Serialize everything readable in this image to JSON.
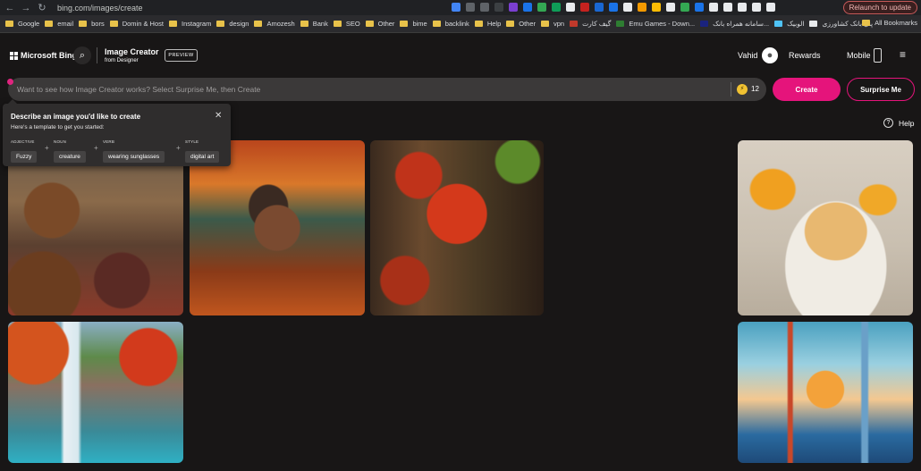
{
  "browser": {
    "url": "bing.com/images/create",
    "relaunch_label": "Relaunch to update",
    "bookmarks": [
      "Google",
      "email",
      "bors",
      "Domin & Host",
      "Instagram",
      "design",
      "Amozesh",
      "Bank",
      "SEO",
      "Other",
      "bime",
      "backlink",
      "Help",
      "Other",
      "vpn",
      "گیف کارت",
      "Emu Games - Down...",
      "سامانه همراه بانک...",
      "الوبیک",
      "پنل بانک کشاورزی"
    ],
    "all_bookmarks_label": "All Bookmarks"
  },
  "header": {
    "brand": "Microsoft Bing",
    "title": "Image Creator",
    "subtitle": "from Designer",
    "preview_badge": "PREVIEW",
    "user_name": "Vahid",
    "rewards": "Rewards",
    "mobile": "Mobile"
  },
  "prompt": {
    "placeholder": "Want to see how Image Creator works? Select Surprise Me, then Create",
    "boost_count": "12",
    "create_label": "Create",
    "surprise_label": "Surprise Me"
  },
  "tooltip": {
    "title": "Describe an image you'd like to create",
    "subtitle": "Here's a template to get you started:",
    "chips": [
      {
        "label": "ADJECTIVE",
        "value": "Fuzzy"
      },
      {
        "label": "NOUN",
        "value": "creature"
      },
      {
        "label": "VERB",
        "value": "wearing sunglasses"
      },
      {
        "label": "STYLE",
        "value": "digital art"
      }
    ]
  },
  "help_label": "Help",
  "images": [
    {
      "name": "bears-cabin-feast"
    },
    {
      "name": "autumn-cabin"
    },
    {
      "name": "red-maple-leaf"
    },
    {
      "name": "pancakes-orange-juice"
    },
    {
      "name": "waterfall-unicorn"
    },
    {
      "name": "paper-city-skyline"
    }
  ]
}
